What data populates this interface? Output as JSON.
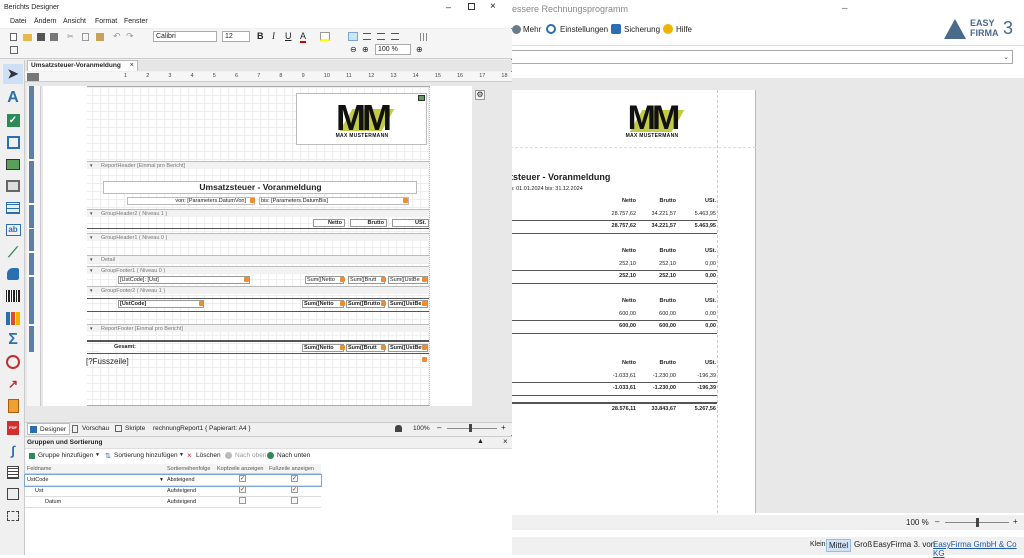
{
  "app_title": "essere Rechnungsprogramm",
  "app_toolbar": {
    "mehr": "Mehr",
    "einstellungen": "Einstellungen",
    "sicherung": "Sicherung",
    "hilfe": "Hilfe"
  },
  "brand": {
    "name": "EASY",
    "name2": "FIRMA",
    "version": "3"
  },
  "designer": {
    "title": "Berichts Designer",
    "menu": [
      "Datei",
      "Ändern",
      "Ansicht",
      "Format",
      "Fenster"
    ],
    "font": "Calibri",
    "font_size": "12",
    "zoom": "100 %",
    "tab": "Umsatzsteuer-Voranmeldung",
    "ruler": [
      "1",
      "2",
      "3",
      "4",
      "5",
      "6",
      "7",
      "8",
      "9",
      "10",
      "11",
      "12",
      "13",
      "14",
      "15",
      "16",
      "17",
      "18"
    ],
    "logo_letters": "MM",
    "logo_sub": "MAX MUSTERMANN",
    "bands": {
      "report_header": "ReportHeader [Einmal pro Bericht]",
      "group_header2": "GroupHeader2 ( Niveau 1 )",
      "group_header1": "GroupHeader1 ( Niveau 0 )",
      "detail": "Detail",
      "group_footer1": "GroupFooter1 ( Niveau 0 )",
      "group_footer2": "GroupFooter2 ( Niveau 1 )",
      "report_footer": "ReportFooter [Einmal pro Bericht]"
    },
    "report_title": "Umsatzsteuer - Voranmeldung",
    "von_field": "von: [Parameters.DatumVon]",
    "bis_field": "bis: [Parameters.DatumBis]",
    "col_netto": "Netto",
    "col_brutto": "Brutto",
    "col_ust": "USt.",
    "ustcode_line": "[UstCode]: [Ust]",
    "sum_netto": "Sum([Netto",
    "sum_brutto": "Sum([Brutt",
    "sum_ust": "Sum([UstBe",
    "ustcode_field": "[UstCode]",
    "sum_netto2": "Sum([Netto",
    "sum_brutto2": "Sum([Brutto",
    "sum_ust2": "Sum([UstBe",
    "gesamt": "Gesamt:",
    "sum_netto3": "Sum([Netto",
    "sum_brutto3": "Sum([Brutt",
    "sum_ust3": "Sum([UstBet",
    "fusszeile": "[?Fusszeile]",
    "bottom_tabs": {
      "designer": "Designer",
      "vorschau": "Vorschau",
      "skripte": "Skripte",
      "report": "rechnungReport1 { Papierart: A4 }"
    },
    "designer_zoom": "100%"
  },
  "gruppen": {
    "title": "Gruppen und Sortierung",
    "add_group": "Gruppe hinzufügen",
    "add_sort": "Sortierung hinzufügen",
    "delete": "Löschen",
    "up": "Nach oben",
    "down": "Nach unten",
    "headers": [
      "Feldname",
      "Sortierreihenfolge",
      "Kopfzeile anzeigen",
      "Fußzeile anzeigen"
    ],
    "rows": [
      {
        "name": "UstCode",
        "order": "Absteigend",
        "kopf": true,
        "fuss": true
      },
      {
        "name": "Ust",
        "order": "Aufsteigend",
        "kopf": true,
        "fuss": true
      },
      {
        "name": "Datum",
        "order": "Aufsteigend",
        "kopf": false,
        "fuss": false
      }
    ]
  },
  "preview": {
    "title": "tsteuer - Voranmeldung",
    "dates": "n: 01.01.2024    bis: 31.12.2024",
    "groups": [
      {
        "headers": [
          "Netto",
          "Brutto",
          "USt."
        ],
        "row": [
          "28.757,62",
          "34.221,57",
          "5.463,95"
        ],
        "total": [
          "28.757,62",
          "34.221,57",
          "5.463,95"
        ]
      },
      {
        "headers": [
          "Netto",
          "Brutto",
          "USt."
        ],
        "row": [
          "252,10",
          "252,10",
          "0,00"
        ],
        "total": [
          "252,10",
          "252,10",
          "0,00"
        ]
      },
      {
        "headers": [
          "Netto",
          "Brutto",
          "USt."
        ],
        "row": [
          "600,00",
          "600,00",
          "0,00"
        ],
        "total": [
          "600,00",
          "600,00",
          "0,00"
        ]
      },
      {
        "headers": [
          "Netto",
          "Brutto",
          "USt."
        ],
        "row": [
          "-1.033,61",
          "-1.230,00",
          "-196,39"
        ],
        "total": [
          "-1.033,61",
          "-1.230,00",
          "-196,39"
        ]
      }
    ],
    "grand_total": [
      "28.576,11",
      "33.843,67",
      "5.267,56"
    ]
  },
  "status": {
    "zoom": "100 %",
    "klein": "Klein",
    "mittel": "Mittel",
    "gross": "Groß",
    "company_prefix": "EasyFirma 3. von",
    "company_link": "EasyFirma GmbH & Co KG"
  },
  "colors": {
    "accent": "#1e5aa8",
    "orange": "#f28c28",
    "logo_band": "#b8c226",
    "brand_text": "#4a6a8a"
  }
}
